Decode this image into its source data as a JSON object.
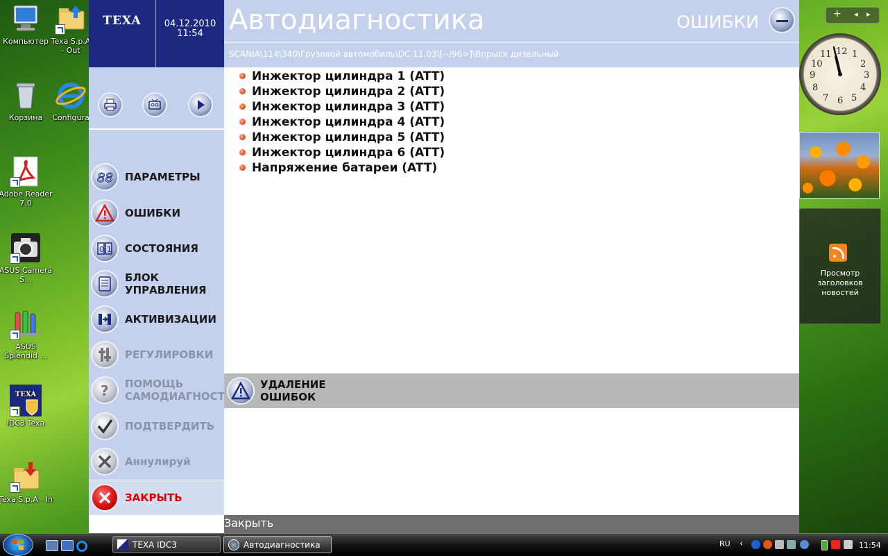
{
  "desktop": {
    "icons": [
      {
        "label": "Компьютер"
      },
      {
        "label": "Texa S.p.A - Out"
      },
      {
        "label": "Корзина"
      },
      {
        "label": "Configura"
      },
      {
        "label": "Adobe Reader 7.0"
      },
      {
        "label": "ASUS Camera S..."
      },
      {
        "label": "ASUS Splendid ..."
      },
      {
        "label": "IDC3 Texa"
      },
      {
        "label": "Texa S.p.A - In"
      }
    ],
    "texa_icon_text": "TEXA"
  },
  "app": {
    "logo": "TEXA",
    "date": "04.12.2010",
    "time": "11:54",
    "title": "Автодиагностика",
    "section": "ОШИБКИ",
    "breadcrumb": "SCANIA\\114\\340\\Грузовой автомобиль\\DC 11.03\\[--/96>]\\Впрыск дизельный",
    "menu": {
      "parameters": "ПАРАМЕТРЫ",
      "errors": "ОШИБКИ",
      "states": "СОСТОЯНИЯ",
      "control_unit": "БЛОК\nУПРАВЛЕНИЯ",
      "activations": "АКТИВИЗАЦИИ",
      "adjustments": "РЕГУЛИРОВКИ",
      "self_diag": "ПОМОЩЬ\nСАМОДИАГНОСТ",
      "confirm": "ПОДТВЕРДИТЬ",
      "cancel": "Аннулируй",
      "close": "ЗАКРЫТЬ"
    },
    "faults": [
      "Инжектор цилиндра 1 (ATT)",
      "Инжектор цилиндра 2 (ATT)",
      "Инжектор цилиндра 3 (ATT)",
      "Инжектор цилиндра 4 (ATT)",
      "Инжектор цилиндра 5 (ATT)",
      "Инжектор цилиндра 6 (ATT)",
      "Напряжение батареи (ATT)"
    ],
    "delete_errors": "УДАЛЕНИЕ\nОШИБОК",
    "status": "Закрыть"
  },
  "gadgets": {
    "controls": [
      "+",
      "◂",
      "▸"
    ],
    "clock_numbers": [
      "12",
      "1",
      "2",
      "3",
      "4",
      "5",
      "6",
      "7",
      "8",
      "9",
      "10",
      "11"
    ],
    "rss_text": "Просмотр заголовков новостей"
  },
  "taskbar": {
    "tasks": [
      {
        "label": "TEXA IDC3"
      },
      {
        "label": "Автодиагностика"
      }
    ],
    "lang": "RU",
    "time": "11:54"
  }
}
